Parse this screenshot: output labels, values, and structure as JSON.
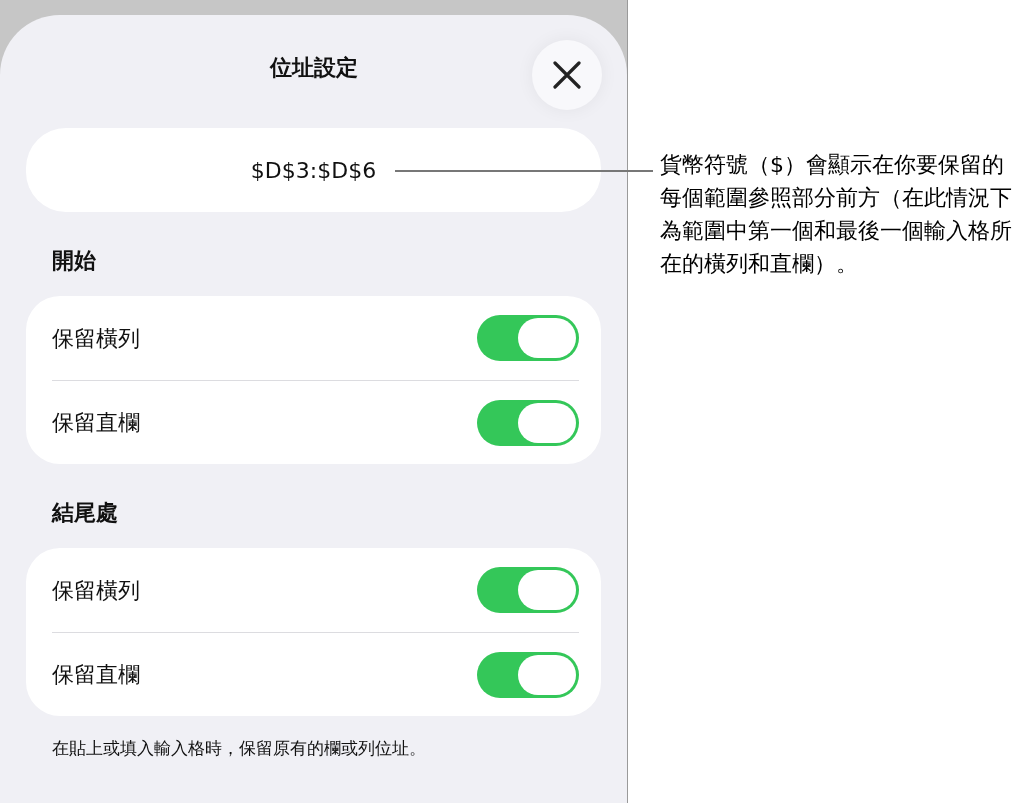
{
  "sheet": {
    "title": "位址設定",
    "address": "$D$3:$D$6",
    "sections": [
      {
        "heading": "開始",
        "rows": [
          {
            "label": "保留橫列",
            "on": true
          },
          {
            "label": "保留直欄",
            "on": true
          }
        ]
      },
      {
        "heading": "結尾處",
        "rows": [
          {
            "label": "保留橫列",
            "on": true
          },
          {
            "label": "保留直欄",
            "on": true
          }
        ]
      }
    ],
    "footnote": "在貼上或填入輸入格時，保留原有的欄或列位址。"
  },
  "callout": {
    "text": "貨幣符號（$）會顯示在你要保留的每個範圍參照部分前方（在此情況下為範圍中第一個和最後一個輸入格所在的橫列和直欄）。"
  }
}
